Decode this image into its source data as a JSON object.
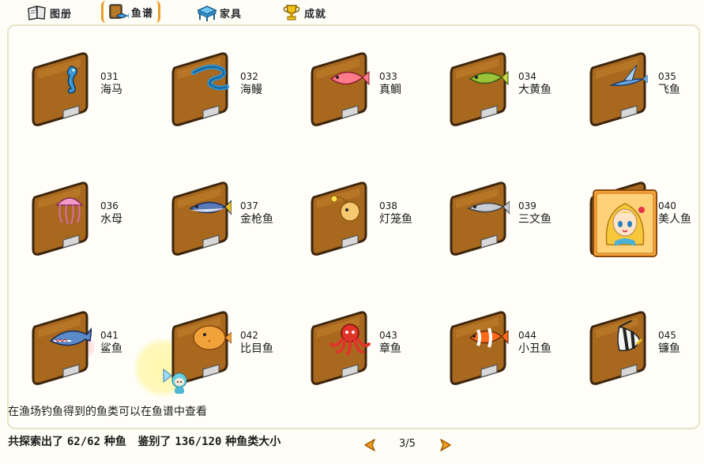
{
  "tabs": [
    {
      "label": "图册",
      "icon": "album-book-icon"
    },
    {
      "label": "鱼谱",
      "icon": "fish-guide-icon"
    },
    {
      "label": "家具",
      "icon": "furniture-icon"
    },
    {
      "label": "成就",
      "icon": "trophy-icon"
    }
  ],
  "active_tab": "鱼谱",
  "fish": [
    {
      "num": "031",
      "name": "海马",
      "icon": "seahorse-icon"
    },
    {
      "num": "032",
      "name": "海鳗",
      "icon": "eel-icon"
    },
    {
      "num": "033",
      "name": "真鲷",
      "icon": "sea-bream-icon"
    },
    {
      "num": "034",
      "name": "大黄鱼",
      "icon": "yellow-croaker-icon"
    },
    {
      "num": "035",
      "name": "飞鱼",
      "icon": "flying-fish-icon"
    },
    {
      "num": "036",
      "name": "水母",
      "icon": "jellyfish-icon"
    },
    {
      "num": "037",
      "name": "金枪鱼",
      "icon": "tuna-icon"
    },
    {
      "num": "038",
      "name": "灯笼鱼",
      "icon": "lanternfish-icon"
    },
    {
      "num": "039",
      "name": "三文鱼",
      "icon": "salmon-icon"
    },
    {
      "num": "040",
      "name": "美人鱼",
      "icon": "mermaid-icon"
    },
    {
      "num": "041",
      "name": "鲨鱼",
      "icon": "shark-icon"
    },
    {
      "num": "042",
      "name": "比目鱼",
      "icon": "flounder-icon"
    },
    {
      "num": "043",
      "name": "章鱼",
      "icon": "octopus-icon"
    },
    {
      "num": "044",
      "name": "小丑鱼",
      "icon": "clownfish-icon"
    },
    {
      "num": "045",
      "name": "镰鱼",
      "icon": "moorish-idol-icon"
    }
  ],
  "hint": "在渔场钓鱼得到的鱼类可以在鱼谱中查看",
  "stats": {
    "explored_prefix": "共探索出了",
    "explored_value": "62/62",
    "explored_suffix": "种鱼",
    "identified_prefix": "鉴别了",
    "identified_value": "136/120",
    "identified_suffix": "种鱼类大小"
  },
  "pager": {
    "current": "3/5",
    "prev_icon": "prev-arrow-icon",
    "next_icon": "next-arrow-icon"
  },
  "colors": {
    "card_brown": "#a8691f",
    "card_border": "#3d250c",
    "accent_orange": "#e8a02a",
    "arrow_orange": "#f0a020"
  }
}
